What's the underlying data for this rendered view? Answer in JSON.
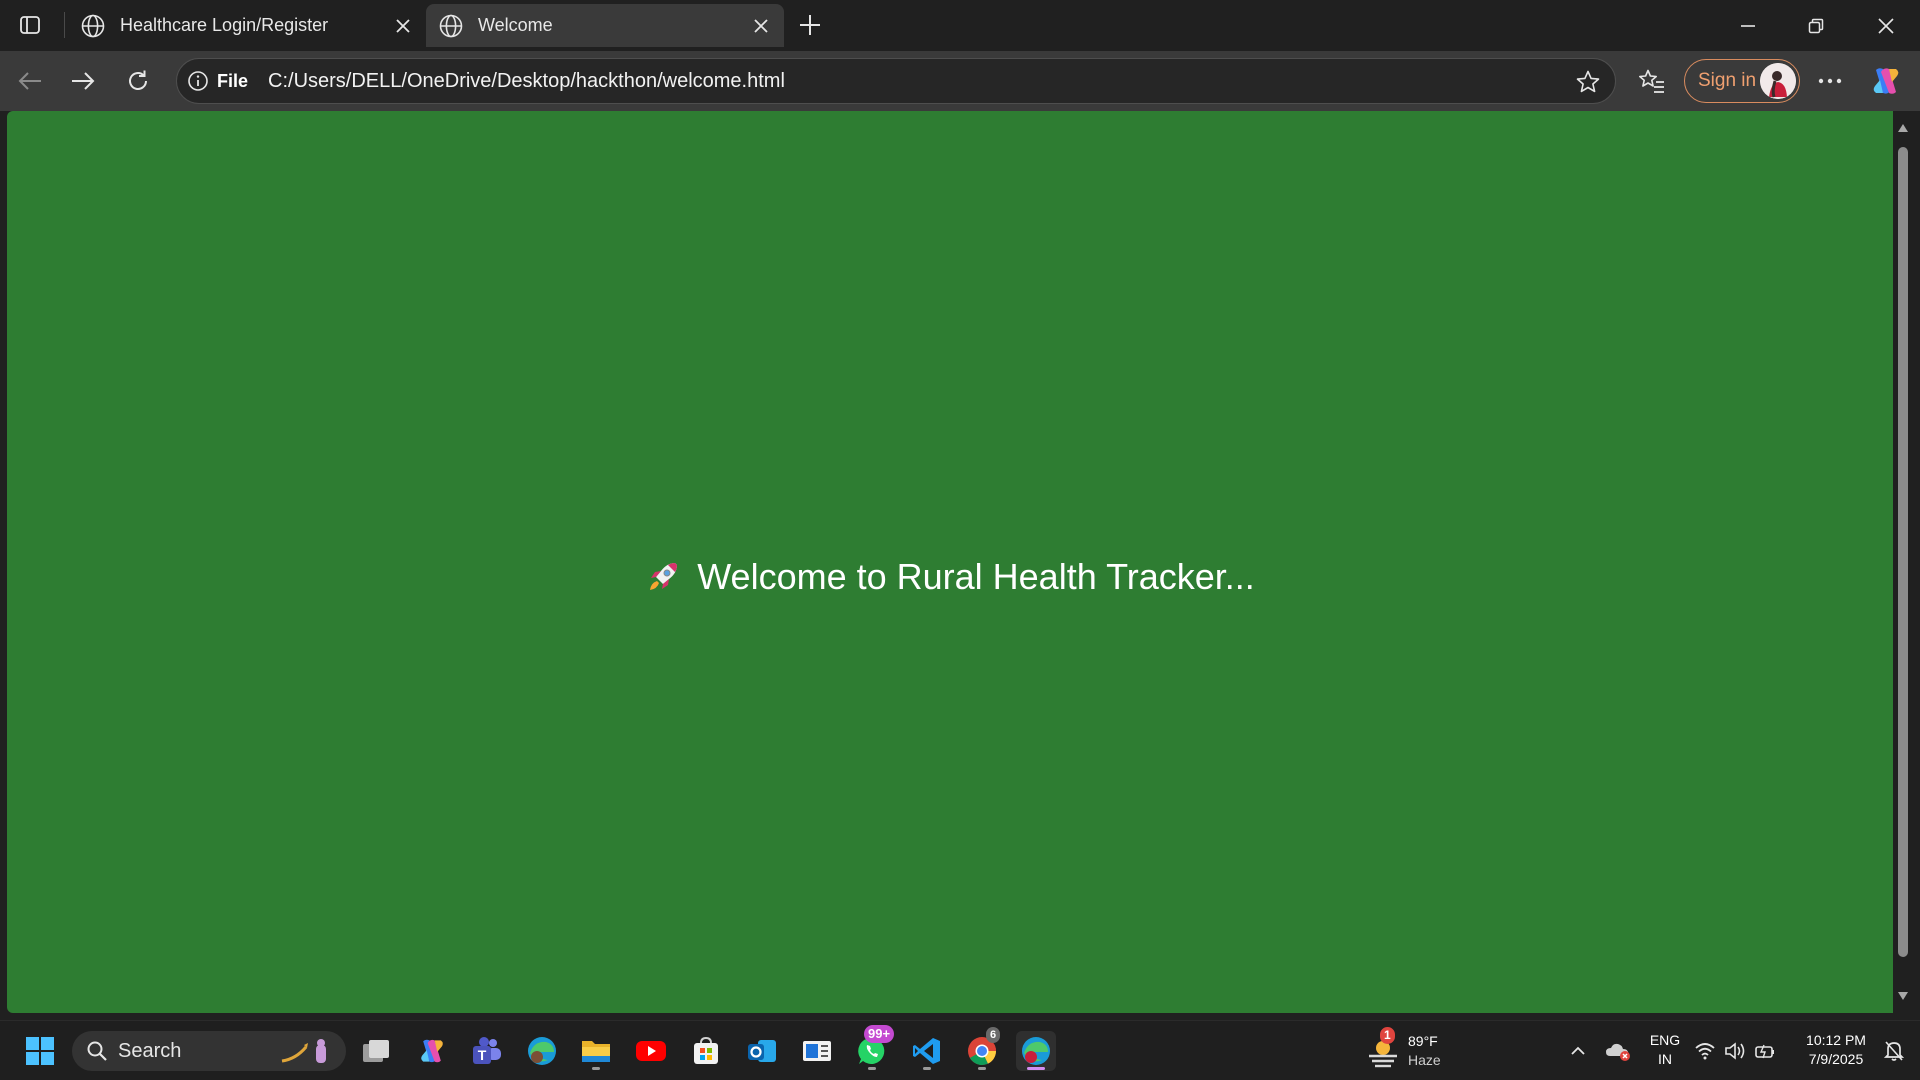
{
  "browser": {
    "tabs": [
      {
        "label": "Healthcare Login/Register",
        "icon": "globe-icon",
        "active": false
      },
      {
        "label": "Welcome",
        "icon": "globe-icon",
        "active": true
      }
    ],
    "address": {
      "scheme_label": "File",
      "url": "C:/Users/DELL/OneDrive/Desktop/hackthon/welcome.html"
    },
    "signin_label": "Sign in"
  },
  "page": {
    "background_color": "#2e7d32",
    "welcome_text": "Welcome to Rural Health Tracker...",
    "welcome_icon": "rocket-icon"
  },
  "taskbar": {
    "search_label": "Search",
    "whatsapp_badge": "99+",
    "chrome_badge": "6",
    "weather": {
      "alert_count": "1",
      "temperature": "89°F",
      "condition": "Haze"
    },
    "language": {
      "line1": "ENG",
      "line2": "IN"
    },
    "clock": {
      "time": "10:12 PM",
      "date": "7/9/2025"
    }
  },
  "colors": {
    "accent_signin": "#f0a070",
    "page_green": "#2e7d32",
    "badge_purple": "#c44ad1"
  }
}
